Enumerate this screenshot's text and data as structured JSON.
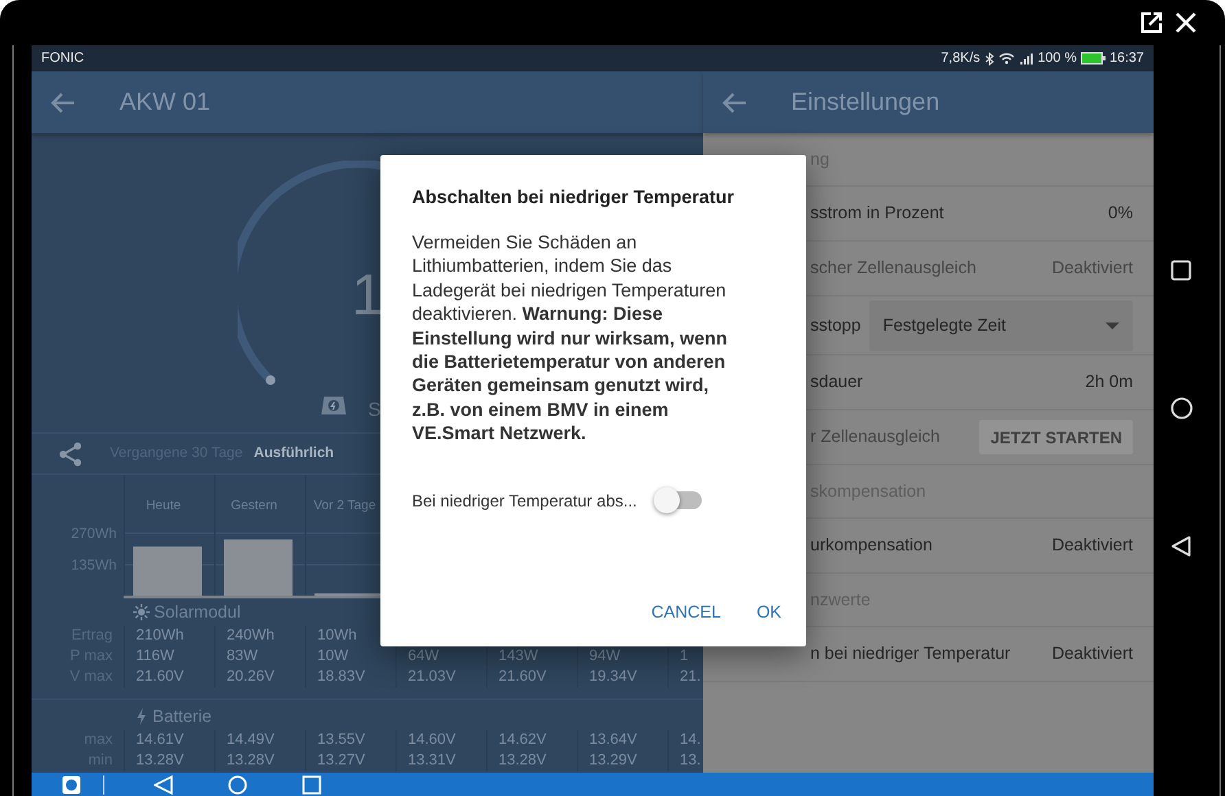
{
  "status_bar": {
    "carrier": "FONIC",
    "speed": "7,8K/s",
    "battery": "100 %",
    "time": "16:37"
  },
  "left_panel": {
    "title": "AKW 01",
    "gauge": {
      "value": "1",
      "caption": "S"
    },
    "tabs": [
      {
        "label": "Vergangene 30 Tage",
        "selected": false
      },
      {
        "label": "Ausführlich",
        "selected": true
      }
    ],
    "chart_data": {
      "type": "bar",
      "categories": [
        "Heute",
        "Gestern",
        "Vor 2 Tage"
      ],
      "values": [
        210,
        240,
        10
      ],
      "ylim": [
        0,
        270
      ],
      "yticks": [
        {
          "value": 135,
          "label": "135Wh"
        },
        {
          "value": 270,
          "label": "270Wh"
        }
      ]
    },
    "sections": [
      {
        "title": "Solarmodul",
        "kind": "solar",
        "rows": [
          {
            "label": "Ertrag",
            "values": [
              "210Wh",
              "240Wh",
              "10Wh"
            ]
          },
          {
            "label": "P max",
            "values": [
              "116W",
              "83W",
              "10W",
              "64W",
              "143W",
              "94W",
              "1"
            ]
          },
          {
            "label": "V max",
            "values": [
              "21.60V",
              "20.26V",
              "18.83V",
              "21.03V",
              "21.60V",
              "19.34V",
              "21."
            ]
          }
        ]
      },
      {
        "title": "Batterie",
        "kind": "battery",
        "rows": [
          {
            "label": "max",
            "values": [
              "14.61V",
              "14.49V",
              "13.55V",
              "14.60V",
              "14.62V",
              "13.64V",
              "14."
            ]
          },
          {
            "label": "min",
            "values": [
              "13.28V",
              "13.28V",
              "13.27V",
              "13.31V",
              "13.28V",
              "13.29V",
              "13."
            ]
          }
        ]
      }
    ]
  },
  "right_panel": {
    "title": "Einstellungen",
    "rows": [
      {
        "kind": "header",
        "label": "ng"
      },
      {
        "kind": "value",
        "label": "sstrom in Prozent",
        "value": "0%",
        "disabled": false
      },
      {
        "kind": "value",
        "label": "scher Zellenausgleich",
        "value": "Deaktiviert",
        "disabled": true
      },
      {
        "kind": "dropdown",
        "label": "sstopp",
        "value": "Festgelegte Zeit",
        "disabled": false
      },
      {
        "kind": "value",
        "label": "sdauer",
        "value": "2h 0m",
        "disabled": false
      },
      {
        "kind": "button",
        "label": "r Zellenausgleich",
        "value": "JETZT STARTEN",
        "disabled": true
      },
      {
        "kind": "header",
        "label": "skompensation"
      },
      {
        "kind": "value",
        "label": "urkompensation",
        "value": "Deaktiviert",
        "disabled": false
      },
      {
        "kind": "header",
        "label": "nzwerte"
      },
      {
        "kind": "value",
        "label": "n bei niedriger Temperatur",
        "value": "Deaktiviert",
        "disabled": false
      }
    ]
  },
  "dialog": {
    "title": "Abschalten bei niedriger Temperatur",
    "body": "Vermeiden Sie Schäden an Lithiumbatterien, indem Sie das Ladegerät bei niedrigen Temperaturen deaktivieren. **Warnung: Diese Einstellung wird nur wirksam, wenn die Batterietemperatur von anderen Geräten gemeinsam genutzt wird, z.B. von einem BMV in einem VE.Smart Netzwerk.**",
    "switch": {
      "label": "Bei niedriger Temperatur abs...",
      "on": false
    },
    "buttons": [
      "CANCEL",
      "OK"
    ]
  }
}
